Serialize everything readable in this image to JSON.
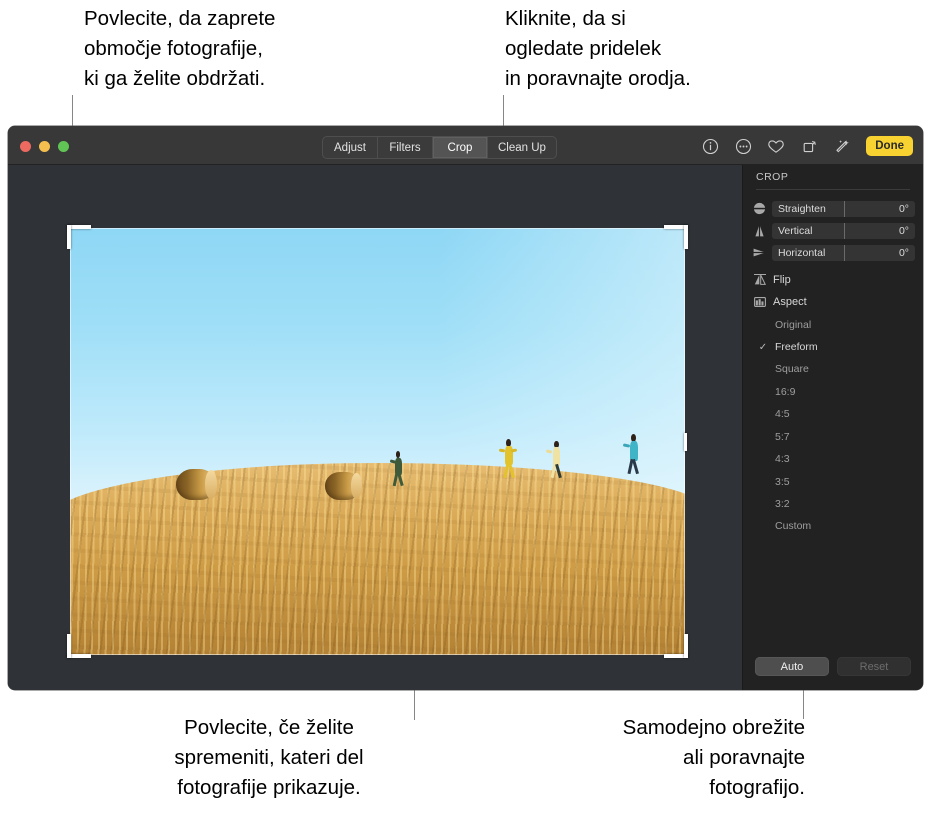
{
  "callouts": {
    "top_left": "Povlecite, da zaprete\nobmočje fotografije,\nki ga želite obdržati.",
    "top_right": "Kliknite, da si\nogledate pridelek\nin poravnajte orodja.",
    "bottom_left": "Povlecite, če želite\nspremeniti, kateri del\nfotografije prikazuje.",
    "bottom_right": "Samodejno obrežite\nali poravnajte\nfotografijo."
  },
  "window": {
    "traffic_lights": {
      "close": "close-button",
      "minimize": "minimize-button",
      "maximize": "maximize-button"
    },
    "segmented_control": {
      "items": [
        {
          "label": "Adjust",
          "active": false
        },
        {
          "label": "Filters",
          "active": false
        },
        {
          "label": "Crop",
          "active": true
        },
        {
          "label": "Clean Up",
          "active": false
        }
      ]
    },
    "toolbar_icons": [
      {
        "name": "info-icon"
      },
      {
        "name": "more-options-icon"
      },
      {
        "name": "favorite-heart-icon"
      },
      {
        "name": "rotate-icon"
      },
      {
        "name": "auto-enhance-icon"
      }
    ],
    "done_label": "Done"
  },
  "sidebar": {
    "title": "CROP",
    "sliders": [
      {
        "icon": "straighten-icon",
        "label": "Straighten",
        "value": "0°"
      },
      {
        "icon": "vertical-perspective-icon",
        "label": "Vertical",
        "value": "0°"
      },
      {
        "icon": "horizontal-perspective-icon",
        "label": "Horizontal",
        "value": "0°"
      }
    ],
    "menus": [
      {
        "icon": "flip-icon",
        "label": "Flip"
      },
      {
        "icon": "aspect-icon",
        "label": "Aspect"
      }
    ],
    "aspect_options": [
      {
        "label": "Original",
        "selected": false
      },
      {
        "label": "Freeform",
        "selected": true
      },
      {
        "label": "Square",
        "selected": false
      },
      {
        "label": "16:9",
        "selected": false
      },
      {
        "label": "4:5",
        "selected": false
      },
      {
        "label": "5:7",
        "selected": false
      },
      {
        "label": "4:3",
        "selected": false
      },
      {
        "label": "3:5",
        "selected": false
      },
      {
        "label": "3:2",
        "selected": false
      },
      {
        "label": "Custom",
        "selected": false
      }
    ],
    "check_glyph": "✓",
    "auto_label": "Auto",
    "reset_label": "Reset"
  },
  "colors": {
    "accent": "#f8d230",
    "window_bg": "#2a2a2a",
    "titlebar_bg": "#383838",
    "sidebar_bg": "#222222",
    "canvas_bg": "#2f3337"
  }
}
